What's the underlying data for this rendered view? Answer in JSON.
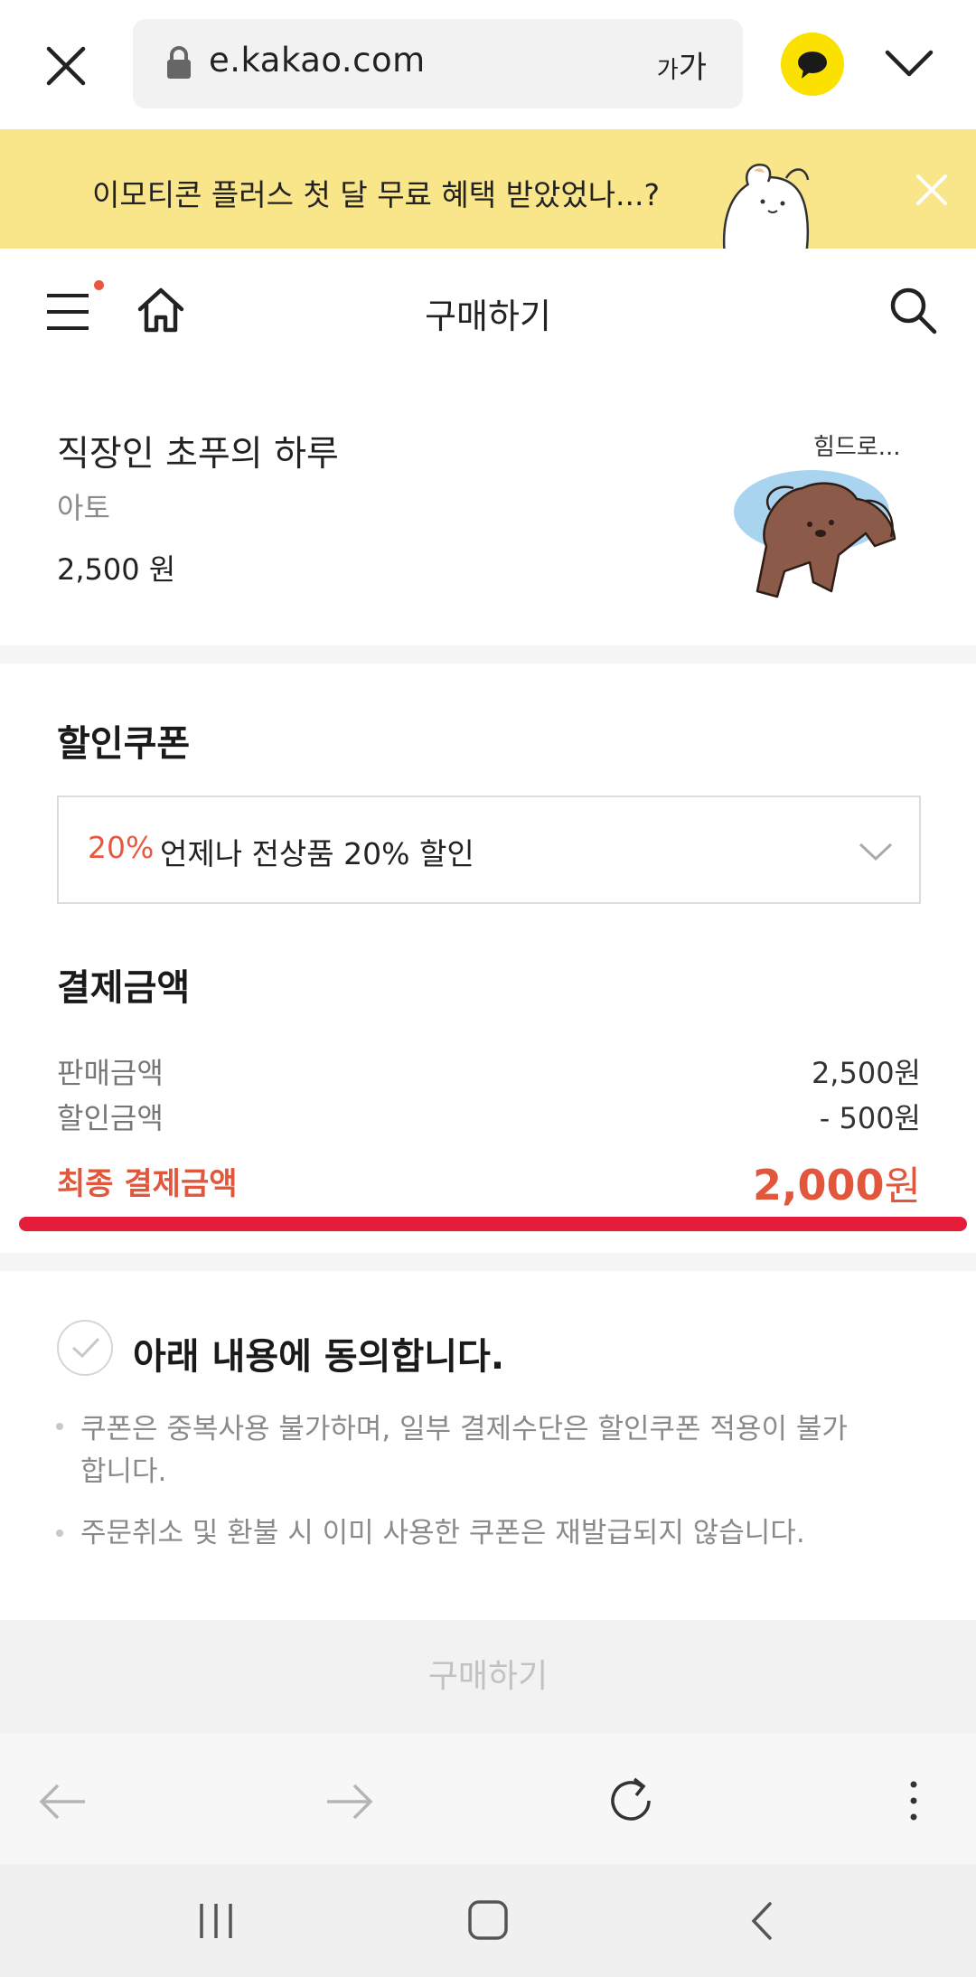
{
  "browser": {
    "url": "e.kakao.com",
    "font_size_small": "가",
    "font_size_large": "가"
  },
  "banner": {
    "text": "이모티콘 플러스 첫 달 무료 혜택 받았었나...?"
  },
  "header": {
    "title": "구매하기"
  },
  "product": {
    "title": "직장인 초푸의 하루",
    "author": "아토",
    "price": "2,500 원",
    "sticker_caption": "힘드로..."
  },
  "coupon": {
    "section_title": "할인쿠폰",
    "selected_rate": "20%",
    "selected_name": "언제나 전상품 20% 할인"
  },
  "payment": {
    "section_title": "결제금액",
    "rows": [
      {
        "label": "판매금액",
        "value": "2,500원"
      },
      {
        "label": "할인금액",
        "value": "- 500원"
      }
    ],
    "final_label": "최종 결제금액",
    "final_amount": "2,000",
    "final_unit": "원"
  },
  "agreement": {
    "title": "아래 내용에 동의합니다.",
    "notices": [
      "쿠폰은 중복사용 불가하며, 일부 결제수단은 할인쿠폰 적용이 불가합니다.",
      "주문취소 및 환불 시 이미 사용한 쿠폰은 재발급되지 않습니다."
    ]
  },
  "buy_button": {
    "label": "구매하기"
  },
  "colors": {
    "accent_red": "#e2573c",
    "underline_red": "#e41e3a",
    "kakao_yellow": "#fae100",
    "banner_yellow": "#f9e58a"
  }
}
